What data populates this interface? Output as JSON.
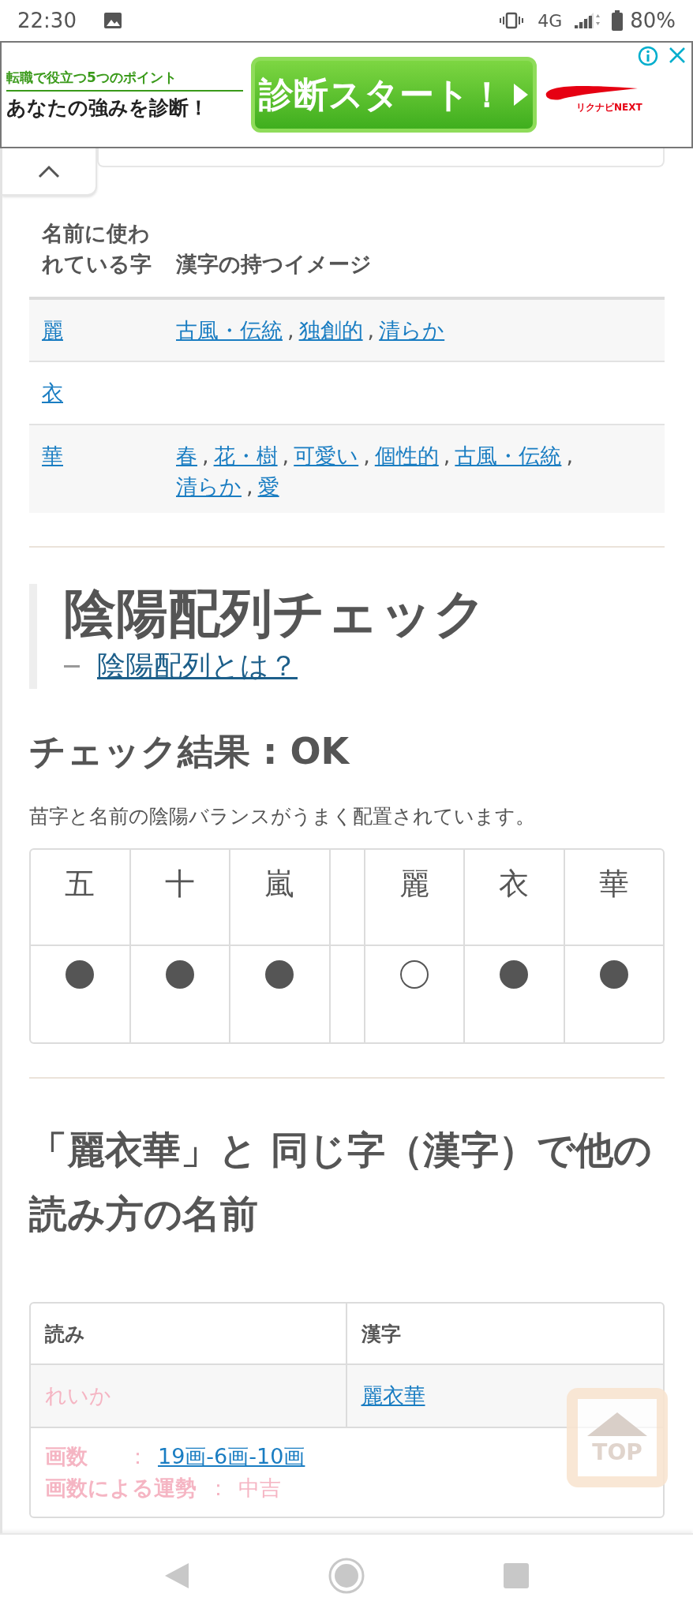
{
  "status_bar": {
    "time": "22:30",
    "network": "4G",
    "battery": "80%"
  },
  "ad": {
    "line_1": "転職で役立つ**5**つのポイント",
    "line_2": "あなたの**強み**を診断！",
    "button": "診断スタート！",
    "logo": "リクナビNEXT"
  },
  "kanji_table": {
    "columns": [
      "名前に使われている字",
      "漢字の持つイメージ"
    ],
    "separator": ",",
    "rows": [
      {
        "char": "麗",
        "images": [
          "古風・伝統",
          "独創的",
          "清らか"
        ]
      },
      {
        "char": "衣",
        "images": []
      },
      {
        "char": "華",
        "images": [
          "春",
          "花・樹",
          "可愛い",
          "個性的",
          "古風・伝統",
          "清らか",
          "愛"
        ]
      }
    ]
  },
  "yinyang": {
    "title": "陰陽配列チェック",
    "link": "陰陽配列とは？",
    "result": "チェック結果 : OK",
    "message": "苗字と名前の陰陽バランスがうまく配置されています。",
    "surname": [
      {
        "char": "五",
        "filled": true
      },
      {
        "char": "十",
        "filled": true
      },
      {
        "char": "嵐",
        "filled": true
      }
    ],
    "given": [
      {
        "char": "麗",
        "filled": false
      },
      {
        "char": "衣",
        "filled": true
      },
      {
        "char": "華",
        "filled": true
      }
    ]
  },
  "same_kanji": {
    "title": "「麗衣華」と 同じ字（漢字）で他の読み方の名前",
    "columns": [
      "読み",
      "漢字"
    ],
    "separator": "：",
    "rows": [
      {
        "reading": "れいか",
        "kanji": "麗衣華",
        "details": [
          {
            "kind": "link",
            "label": "画数",
            "value": "19画-6画-10画"
          },
          {
            "kind": "text",
            "label": "画数による運勢",
            "value": "中吉"
          }
        ]
      }
    ]
  },
  "top_button": {
    "label": "TOP"
  }
}
